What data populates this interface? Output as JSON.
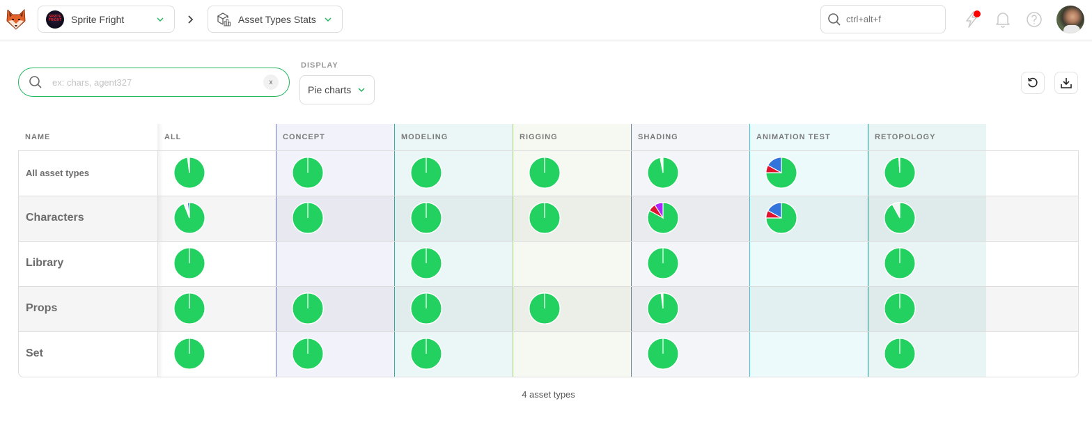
{
  "topbar": {
    "production": "Sprite Fright",
    "production_thumb_text": "SPRITE FRIGHT",
    "page": "Asset Types Stats",
    "global_search_placeholder": "ctrl+alt+f"
  },
  "filters": {
    "search_placeholder": "ex: chars, agent327",
    "search_value": "",
    "clear_label": "x",
    "display_label": "DISPLAY",
    "display_value": "Pie charts"
  },
  "colors": {
    "accent": "#22b660",
    "done": "#22d160",
    "wip": "#3273dc",
    "retake": "#e0142e",
    "wfa": "#ab26ff",
    "todo": "#f5f5f5",
    "notification": "#ff0000"
  },
  "table": {
    "name_header": "NAME",
    "columns": [
      {
        "label": "ALL",
        "bg": "#ffffff",
        "border": "#e0e0e0"
      },
      {
        "label": "CONCEPT",
        "bg": "#f0f1fa",
        "border": "#5c6bc0"
      },
      {
        "label": "MODELING",
        "bg": "#eaf6f6",
        "border": "#26a69a"
      },
      {
        "label": "RIGGING",
        "bg": "#f6f9f1",
        "border": "#9ccc65"
      },
      {
        "label": "SHADING",
        "bg": "#f4f5f8",
        "border": "#607d8b"
      },
      {
        "label": "ANIMATION TEST",
        "bg": "#ecfafc",
        "border": "#26c6da"
      },
      {
        "label": "RETOPOLOGY",
        "bg": "#e8f5f5",
        "border": "#00897b"
      }
    ],
    "rows": [
      {
        "label": "All asset types",
        "small": true,
        "cells": [
          [
            {
              "s": "done",
              "v": 98
            },
            {
              "s": "todo",
              "v": 2
            }
          ],
          [
            {
              "s": "done",
              "v": 100
            }
          ],
          [
            {
              "s": "done",
              "v": 100
            }
          ],
          [
            {
              "s": "done",
              "v": 100
            }
          ],
          [
            {
              "s": "done",
              "v": 97
            },
            {
              "s": "retake",
              "v": 1
            },
            {
              "s": "todo",
              "v": 2
            }
          ],
          [
            {
              "s": "done",
              "v": 75
            },
            {
              "s": "retake",
              "v": 8
            },
            {
              "s": "wip",
              "v": 17
            }
          ],
          [
            {
              "s": "done",
              "v": 99
            },
            {
              "s": "todo",
              "v": 1
            }
          ]
        ]
      },
      {
        "label": "Characters",
        "small": false,
        "cells": [
          [
            {
              "s": "done",
              "v": 94
            },
            {
              "s": "retake",
              "v": 1
            },
            {
              "s": "todo",
              "v": 3
            },
            {
              "s": "wip",
              "v": 2
            }
          ],
          [
            {
              "s": "done",
              "v": 100
            }
          ],
          [
            {
              "s": "done",
              "v": 100
            }
          ],
          [
            {
              "s": "done",
              "v": 100
            }
          ],
          [
            {
              "s": "done",
              "v": 83
            },
            {
              "s": "retake",
              "v": 8
            },
            {
              "s": "wfa",
              "v": 9
            }
          ],
          [
            {
              "s": "done",
              "v": 75
            },
            {
              "s": "retake",
              "v": 8
            },
            {
              "s": "wip",
              "v": 17
            }
          ],
          [
            {
              "s": "done",
              "v": 92
            },
            {
              "s": "todo",
              "v": 8
            }
          ]
        ]
      },
      {
        "label": "Library",
        "small": false,
        "cells": [
          [
            {
              "s": "done",
              "v": 100
            }
          ],
          null,
          [
            {
              "s": "done",
              "v": 100
            }
          ],
          null,
          [
            {
              "s": "done",
              "v": 100
            }
          ],
          null,
          [
            {
              "s": "done",
              "v": 100
            }
          ]
        ]
      },
      {
        "label": "Props",
        "small": false,
        "cells": [
          [
            {
              "s": "done",
              "v": 100
            }
          ],
          [
            {
              "s": "done",
              "v": 100
            }
          ],
          [
            {
              "s": "done",
              "v": 100
            }
          ],
          [
            {
              "s": "done",
              "v": 100
            }
          ],
          [
            {
              "s": "done",
              "v": 98
            },
            {
              "s": "todo",
              "v": 2
            }
          ],
          null,
          [
            {
              "s": "done",
              "v": 100
            }
          ]
        ]
      },
      {
        "label": "Set",
        "small": false,
        "cells": [
          [
            {
              "s": "done",
              "v": 100
            }
          ],
          [
            {
              "s": "done",
              "v": 100
            }
          ],
          [
            {
              "s": "done",
              "v": 100
            }
          ],
          null,
          [
            {
              "s": "done",
              "v": 100
            }
          ],
          null,
          [
            {
              "s": "done",
              "v": 100
            }
          ]
        ]
      }
    ]
  },
  "footer": {
    "count_text": "4 asset types"
  }
}
